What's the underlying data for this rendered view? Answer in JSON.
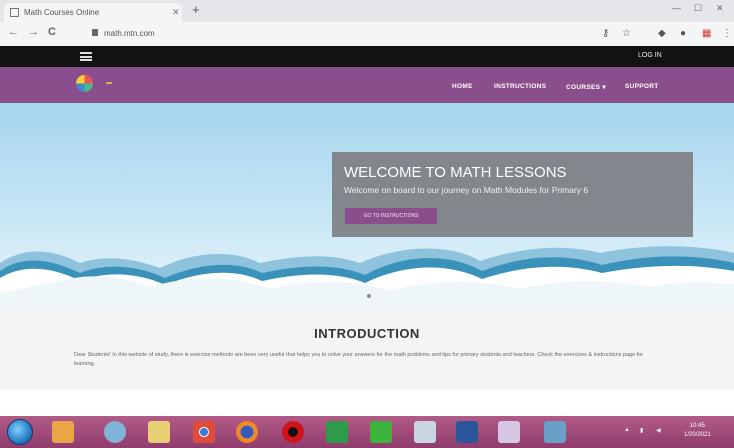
{
  "browser": {
    "tab_title": "Math Courses Online",
    "tab_close": "✕",
    "new_tab": "+",
    "url": "math.mtn.com",
    "nav": {
      "back": "←",
      "forward": "→",
      "reload": "C"
    },
    "window_controls": [
      "—",
      "☐",
      "✕"
    ],
    "toolbar_icons": [
      "key-icon",
      "star-icon",
      "extensions-icon",
      "menu-icon"
    ]
  },
  "site": {
    "login_label": "LOG IN",
    "nav": [
      "HOME",
      "INSTRUCTIONS",
      "COURSES ▾",
      "SUPPORT"
    ],
    "hero": {
      "title": "WELCOME TO MATH LESSONS",
      "subtitle": "Welcome on board to our journey on Math Modules for Primary 6",
      "button_label": "GO TO INSTRUCTIONS"
    },
    "intro": {
      "title": "INTRODUCTION",
      "text": "Dear Students! In this website of study, there is exercise methods are been very useful that helps you to solve your answers for the math problems and tips for primary students and teachers. Check the exercises & instructions page for learning."
    },
    "colors": {
      "brand_purple": "#8b4e8c",
      "top_bar": "#121212",
      "hero_box": "#7d8084"
    }
  },
  "taskbar": {
    "apps": [
      "ie-icon",
      "folder-icon",
      "media-player-icon",
      "explorer-icon",
      "chrome-icon",
      "firefox-icon",
      "opera-icon",
      "excel-icon",
      "camtasia-icon",
      "tool-icon",
      "word-icon",
      "paint-icon",
      "image-viewer-icon"
    ],
    "clock": {
      "time": "10:45",
      "date": "1/20/2021"
    }
  }
}
